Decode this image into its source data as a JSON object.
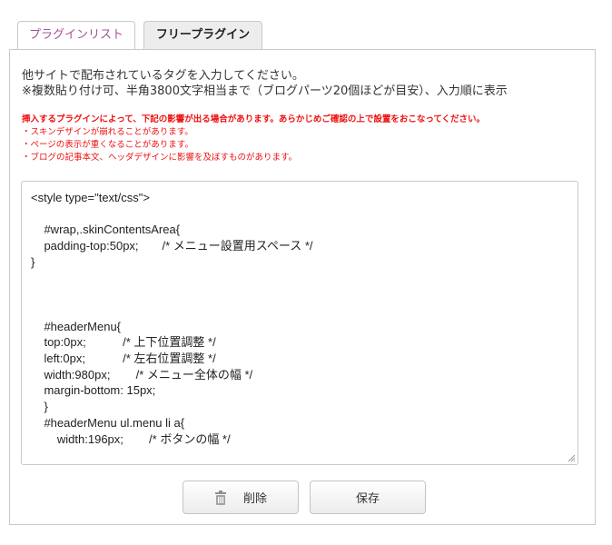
{
  "tabs": {
    "plugin_list": "プラグインリスト",
    "free_plugin": "フリープラグイン"
  },
  "intro": {
    "line1": "他サイトで配布されているタグを入力してください。",
    "line2": "※複数貼り付け可、半角3800文字相当まで（ブログパーツ20個ほどが目安）、入力順に表示"
  },
  "warnings": {
    "heading": "挿入するプラグインによって、下記の影響が出る場合があります。あらかじめご確認の上で設置をおこなってください。",
    "items": [
      "・スキンデザインが崩れることがあります。",
      "・ページの表示が重くなることがあります。",
      "・ブログの記事本文、ヘッダデザインに影響を及ぼすものがあります。"
    ]
  },
  "editor": {
    "code": "<style type=\"text/css\">\n\n\t#wrap,.skinContentsArea{\n\tpadding-top:50px;\t\t/* メニュー設置用スペース */\n}\n\n\n\n\t#headerMenu{\n\ttop:0px;\t\t\t/* 上下位置調整 */\n\tleft:0px;\t\t\t/* 左右位置調整 */\n\twidth:980px;\t\t/* メニュー全体の幅 */\n\tmargin-bottom: 15px;\n\t}\n\t#headerMenu ul.menu li a{\n\t\twidth:196px;\t\t/* ボタンの幅 */"
  },
  "buttons": {
    "delete": "削除",
    "save": "保存"
  },
  "icons": {
    "delete": "trash-icon",
    "grip": "resize-grip-icon"
  },
  "colors": {
    "warning": "#ee1111",
    "tab_link": "#a8509c",
    "border": "#c9c9c9"
  }
}
